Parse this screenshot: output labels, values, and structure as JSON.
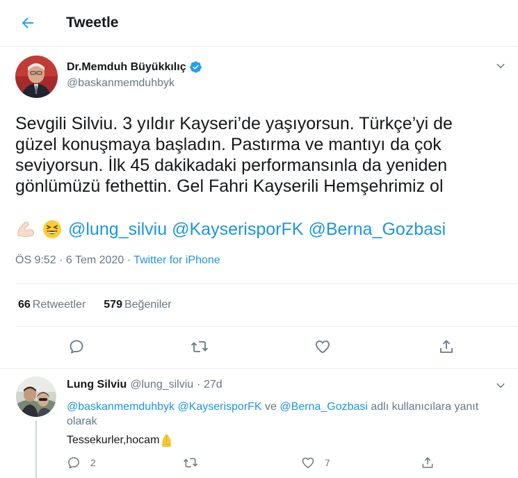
{
  "header": {
    "title": "Tweetle"
  },
  "tweet": {
    "author_name": "Dr.Memduh Büyükkılıç",
    "author_handle": "@baskanmemduhbyk",
    "text": "Sevgili Silviu. 3 yıldır Kayseri’de yaşıyorsun. Türkçe’yi de\ngüzel konuşmaya başladın. Pastırma ve mantıyı da çok\nseviyorsun. İlk 45 dakikadaki performansınla da yeniden\ngönlümüzü fethettin. Gel Fahri Kayserili Hemşehrimiz ol",
    "emojis": [
      "flexed-biceps-emoji",
      "grinning-squinting-face-emoji"
    ],
    "mentions": [
      "@lung_silviu",
      "@KayserisporFK",
      "@Berna_Gozbasi"
    ],
    "time": "ÖS 9:52 · 6 Tem 2020 · ",
    "source": "Twitter for iPhone",
    "retweets_count": "66",
    "retweets_label": "Retweetler",
    "likes_count": "579",
    "likes_label": "Beğeniler",
    "colors": {
      "link": "#1b95e0",
      "verified": "#1da1f2",
      "muted": "#657786"
    }
  },
  "reply": {
    "name": "Lung Silviu",
    "handle": "@lung_silviu",
    "time": "· 27d",
    "reply_mention_1": "@baskanmemduhbyk",
    "reply_mention_2": "@KayserisporFK",
    "reply_connector": " ve ",
    "reply_mention_3": "@Berna_Gozbasi",
    "reply_suffix": " adlı kullanıcılara yanıt olarak",
    "text": "Tessekurler,hocam",
    "text_emoji": "folded-hands-emoji",
    "reply_count": "2",
    "like_count": "7"
  }
}
